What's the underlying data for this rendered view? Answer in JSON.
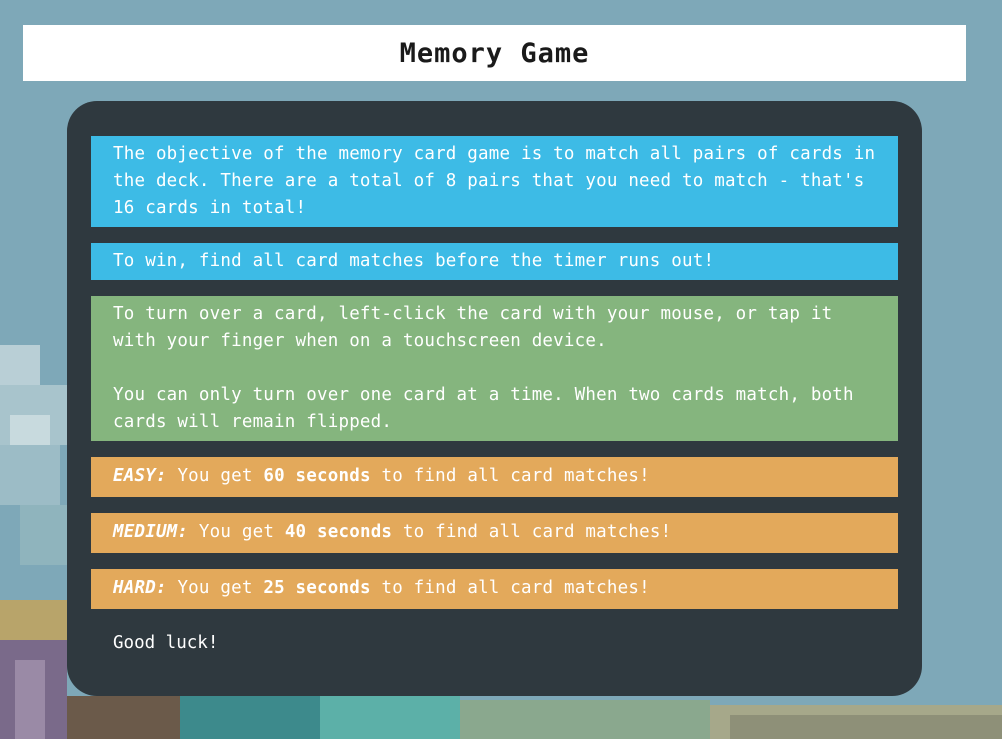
{
  "header": {
    "title": "Memory Game"
  },
  "instructions": {
    "objective": "The objective of the memory card game is to match all pairs of cards in the deck. There are a total of 8 pairs that you need to match - that's 16 cards in total!",
    "win": "To win, find all card matches before the timer runs out!",
    "turn_over": "To turn over a card, left-click the card with your mouse, or tap it with your finger when on a touchscreen device.",
    "one_at_a_time": "You can only turn over one card at a time. When two cards match, both cards will remain flipped.",
    "levels": [
      {
        "name": "EASY:",
        "prefix": "You get",
        "seconds": "60 seconds",
        "suffix": "to find all card matches!"
      },
      {
        "name": "MEDIUM:",
        "prefix": "You get",
        "seconds": "40 seconds",
        "suffix": "to find all card matches!"
      },
      {
        "name": "HARD:",
        "prefix": "You get",
        "seconds": "25 seconds",
        "suffix": "to find all card matches!"
      }
    ],
    "good_luck": "Good luck!"
  },
  "colors": {
    "info_blue": "#3dbbe6",
    "info_green": "#85b57e",
    "level_orange": "#e3a95b",
    "panel": "#2b3338"
  }
}
